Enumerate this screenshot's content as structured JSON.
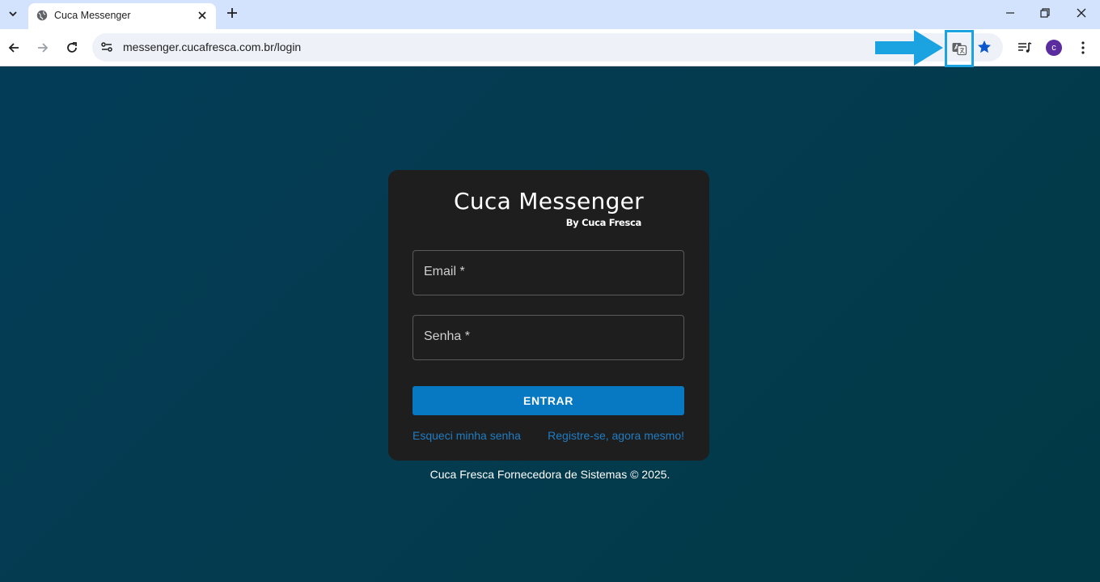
{
  "browser": {
    "tab": {
      "title": "Cuca Messenger"
    },
    "address_bar": {
      "url": "messenger.cucafresca.com.br/login"
    },
    "profile": {
      "initial": "c",
      "color": "#5a2ca0"
    },
    "annotation": {
      "arrow_color": "#1aa3e0",
      "highlight": "translate-icon"
    }
  },
  "login": {
    "brand_title": "Cuca Messenger",
    "brand_subtitle": "By Cuca Fresca",
    "email_label": "Email *",
    "password_label": "Senha *",
    "submit_label": "ENTRAR",
    "forgot_link": "Esqueci minha senha",
    "register_link": "Registre-se, agora mesmo!"
  },
  "footer": {
    "text": "Cuca Fresca Fornecedora de Sistemas © 2025."
  },
  "colors": {
    "primary": "#0778c2",
    "link": "#1f7dc4",
    "card": "#1e1e1e"
  }
}
